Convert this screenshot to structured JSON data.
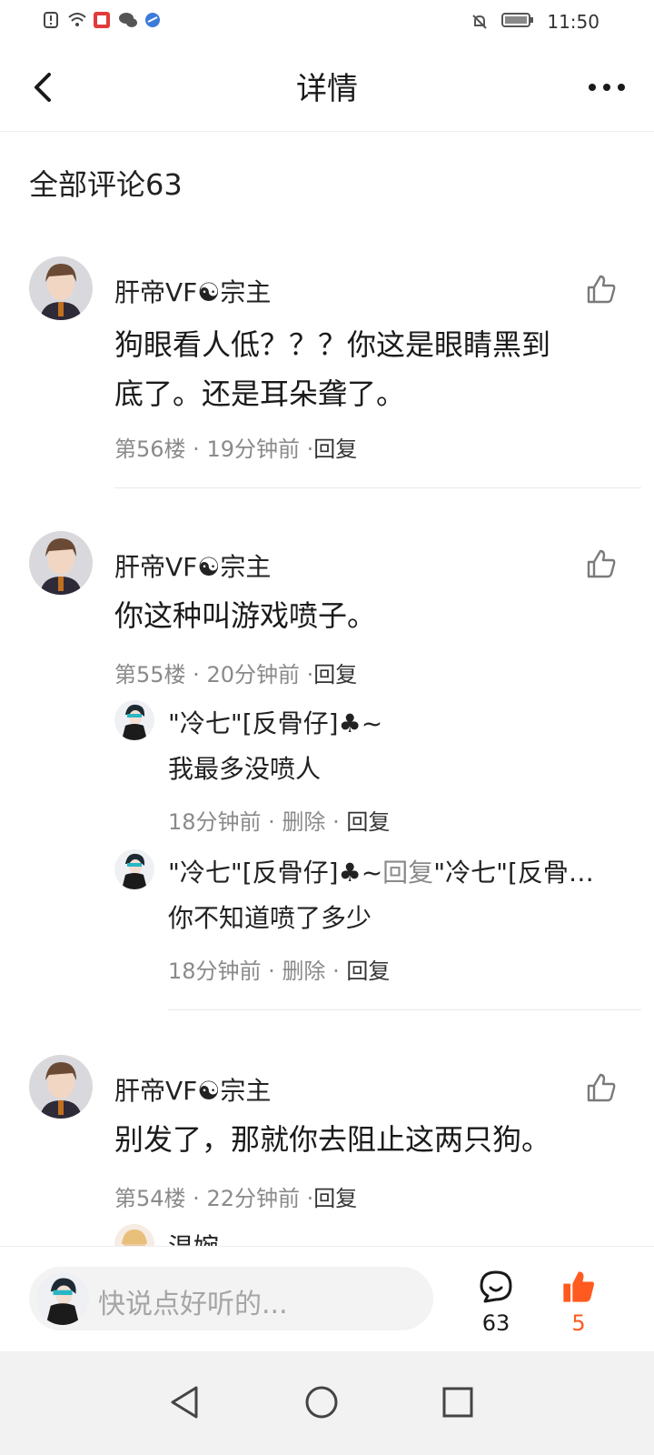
{
  "status_bar": {
    "time": "11:50"
  },
  "header": {
    "title": "详情"
  },
  "comments_header": "全部评论63",
  "comments": [
    {
      "author": "肝帝VF☯宗主",
      "text_lines": [
        "狗眼看人低？？？你这是眼睛黑到",
        "底了。还是耳朵聋了。"
      ],
      "floor": "第56楼",
      "time": "19分钟前",
      "reply": "回复"
    },
    {
      "author": "肝帝VF☯宗主",
      "text": "你这种叫游戏喷子。",
      "floor": "第55楼",
      "time": "20分钟前",
      "reply": "回复",
      "replies": [
        {
          "author": "\"冷七\"[反骨仔]♣~",
          "text": "我最多没喷人",
          "time": "18分钟前",
          "delete": "删除",
          "reply": "回复"
        },
        {
          "author": "\"冷七\"[反骨仔]♣~",
          "reply_word": "回复",
          "reply_to": "\"冷七\"[反骨…",
          "text": "你不知道喷了多少",
          "time": "18分钟前",
          "delete": "删除",
          "reply": "回复"
        }
      ]
    },
    {
      "author": "肝帝VF☯宗主",
      "text": "别发了，那就你去阻止这两只狗。",
      "floor": "第54楼",
      "time": "22分钟前",
      "reply": "回复",
      "partial_reply_author": "温婉"
    }
  ],
  "bottom_bar": {
    "input_placeholder": "快说点好听的...",
    "comment_count": "63",
    "like_count": "5"
  },
  "colors": {
    "accent": "#ff5a1f",
    "muted": "#8a8a8a",
    "text": "#1a1a1a"
  },
  "icons": [
    "back-arrow-icon",
    "more-dots-icon",
    "thumb-up-icon",
    "comment-bubble-icon",
    "thumb-up-filled-icon",
    "nav-back-icon",
    "nav-home-icon",
    "nav-recents-icon"
  ]
}
